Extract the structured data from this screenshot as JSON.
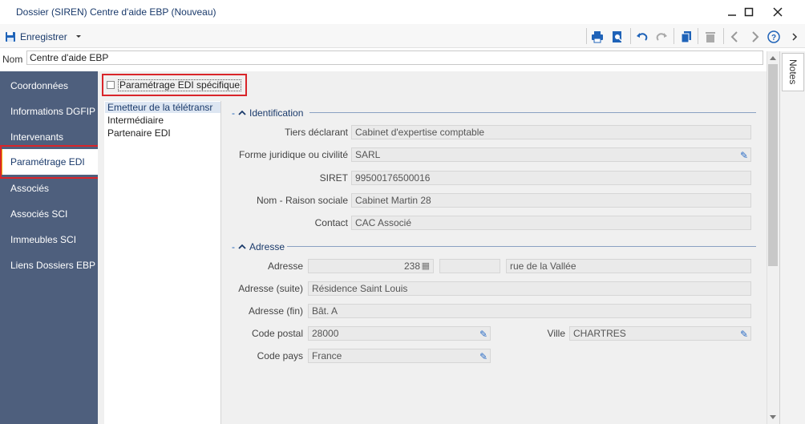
{
  "window": {
    "title": "Dossier (SIREN) Centre d'aide EBP (Nouveau)",
    "controls": [
      "minimize-icon",
      "maximize-icon",
      "close-icon"
    ]
  },
  "toolbar": {
    "save_label": "Enregistrer",
    "icons": [
      "print-icon",
      "preview-icon",
      "undo-icon",
      "redo-icon",
      "copy-icon",
      "delete-icon",
      "prev-icon",
      "next-icon",
      "help-icon",
      "more-icon"
    ]
  },
  "nom": {
    "label": "Nom",
    "value": "Centre d'aide EBP"
  },
  "sidebar": {
    "items": [
      {
        "label": "Coordonnées"
      },
      {
        "label": "Informations DGFIP"
      },
      {
        "label": "Intervenants"
      },
      {
        "label": "Paramétrage EDI"
      },
      {
        "label": "Associés"
      },
      {
        "label": "Associés SCI"
      },
      {
        "label": "Immeubles SCI"
      },
      {
        "label": "Liens Dossiers EBP"
      }
    ],
    "active_index": 3
  },
  "edi": {
    "checkbox_label": "Paramétrage EDI spécifique",
    "checked": false
  },
  "list": {
    "items": [
      "Emetteur de la télétransr",
      "Intermédiaire",
      "Partenaire EDI"
    ],
    "selected_index": 0
  },
  "identification": {
    "title": "Identification",
    "tiers_label": "Tiers déclarant",
    "tiers_value": "Cabinet d'expertise comptable",
    "forme_label": "Forme juridique ou civilité",
    "forme_value": "SARL",
    "siret_label": "SIRET",
    "siret_value": "99500176500016",
    "nom_label": "Nom - Raison sociale",
    "nom_value": "Cabinet Martin 28",
    "contact_label": "Contact",
    "contact_value": "CAC Associé"
  },
  "adresse": {
    "title": "Adresse",
    "adresse_label": "Adresse",
    "numero": "238",
    "complement": "",
    "voie": "rue de la Vallée",
    "suite_label": "Adresse (suite)",
    "suite_value": "Résidence Saint Louis",
    "fin_label": "Adresse (fin)",
    "fin_value": "Bât. A",
    "cp_label": "Code postal",
    "cp_value": "28000",
    "ville_label": "Ville",
    "ville_value": "CHARTRES",
    "pays_label": "Code pays",
    "pays_value": "France"
  },
  "notes": {
    "label": "Notes"
  },
  "colors": {
    "sidebar_bg": "#4e5f7d",
    "accent": "#1a3a6b",
    "highlight": "#d9252a",
    "active_marker": "#f0b400"
  }
}
